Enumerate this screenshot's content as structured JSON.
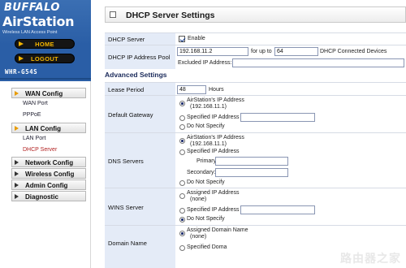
{
  "brand": {
    "logo": "BUFFALO",
    "product": "AirStation",
    "tagline": "Wireless LAN Access Point",
    "model": "WHR-G54S"
  },
  "top_nav": {
    "home": "HOME",
    "logout": "LOGOUT"
  },
  "menu": {
    "wan_config": "WAN Config",
    "wan_port": "WAN Port",
    "pppoe": "PPPoE",
    "lan_config": "LAN Config",
    "lan_port": "LAN Port",
    "dhcp_server": "DHCP Server",
    "network_config": "Network Config",
    "wireless_config": "Wireless Config",
    "admin_config": "Admin Config",
    "diagnostic": "Diagnostic"
  },
  "page": {
    "title": "DHCP Server Settings"
  },
  "dhcp": {
    "server_label": "DHCP Server",
    "enable_label": "Enable",
    "enabled": true,
    "pool_label": "DHCP IP Address Pool",
    "pool_start": "192.168.11.2",
    "for_up_to": "for up to",
    "pool_count": "64",
    "connected_devices": "DHCP Connected Devices",
    "excluded_label": "Excluded IP Address:",
    "excluded_value": ""
  },
  "advanced": {
    "heading": "Advanced Settings",
    "lease_label": "Lease Period",
    "lease_value": "48",
    "lease_unit": "Hours",
    "gateway": {
      "label": "Default Gateway",
      "opt1": "AirStation's IP Address",
      "opt1_sub": "(192.168.11.1)",
      "opt2": "Specified IP Address",
      "opt3": "Do Not Specify",
      "selected": 1
    },
    "dns": {
      "label": "DNS Servers",
      "opt1": "AirStation's IP Address",
      "opt1_sub": "(192.168.11.1)",
      "opt2": "Specified IP Address",
      "primary": "Primary:",
      "secondary": "Secondary:",
      "opt3": "Do Not Specify",
      "selected": 1
    },
    "wins": {
      "label": "WINS Server",
      "opt1": "Assigned IP Address",
      "opt1_sub": "(none)",
      "opt2": "Specified IP Address",
      "opt3": "Do Not Specify",
      "selected": 3
    },
    "domain": {
      "label": "Domain Name",
      "opt1": "Assigned Domain Name",
      "opt1_sub": "(none)",
      "opt2": "Specified Doma",
      "selected": 1
    }
  },
  "watermark": "路由器之家"
}
